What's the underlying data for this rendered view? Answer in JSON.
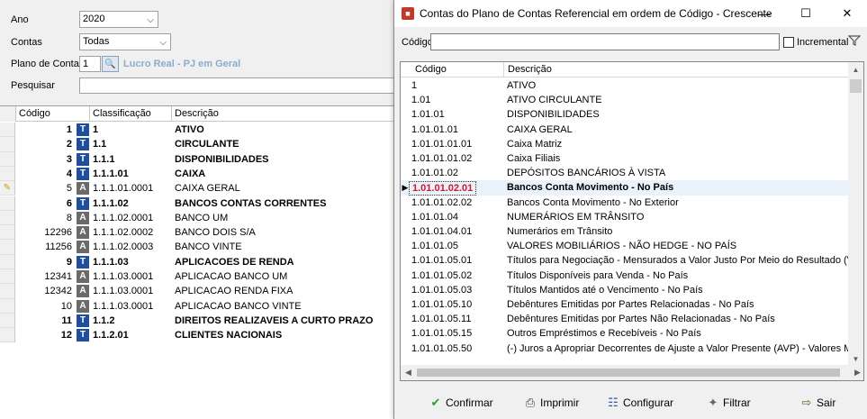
{
  "form": {
    "ano_label": "Ano",
    "ano_value": "2020",
    "contas_label": "Contas",
    "contas_value": "Todas",
    "plano_label": "Plano de Contas",
    "plano_value": "1",
    "plano_desc": "Lucro Real - PJ em Geral",
    "pesquisar_label": "Pesquisar"
  },
  "left_grid": {
    "headers": [
      "Código",
      "Classificação",
      "Descrição"
    ],
    "rows": [
      {
        "code": "1",
        "type": "T",
        "cls": "1",
        "desc": "ATIVO",
        "bold": true
      },
      {
        "code": "2",
        "type": "T",
        "cls": "1.1",
        "desc": "CIRCULANTE",
        "bold": true
      },
      {
        "code": "3",
        "type": "T",
        "cls": "1.1.1",
        "desc": "DISPONIBILIDADES",
        "bold": true
      },
      {
        "code": "4",
        "type": "T",
        "cls": "1.1.1.01",
        "desc": "CAIXA",
        "bold": true
      },
      {
        "code": "5",
        "type": "A",
        "cls": "1.1.1.01.0001",
        "desc": "CAIXA GERAL",
        "bold": false,
        "editing": true
      },
      {
        "code": "6",
        "type": "T",
        "cls": "1.1.1.02",
        "desc": "BANCOS CONTAS CORRENTES",
        "bold": true
      },
      {
        "code": "8",
        "type": "A",
        "cls": "1.1.1.02.0001",
        "desc": "BANCO UM",
        "bold": false
      },
      {
        "code": "12296",
        "type": "A",
        "cls": "1.1.1.02.0002",
        "desc": "BANCO DOIS S/A",
        "bold": false
      },
      {
        "code": "11256",
        "type": "A",
        "cls": "1.1.1.02.0003",
        "desc": "BANCO VINTE",
        "bold": false
      },
      {
        "code": "9",
        "type": "T",
        "cls": "1.1.1.03",
        "desc": "APLICACOES DE RENDA",
        "bold": true
      },
      {
        "code": "12341",
        "type": "A",
        "cls": "1.1.1.03.0001",
        "desc": "APLICACAO BANCO UM",
        "bold": false
      },
      {
        "code": "12342",
        "type": "A",
        "cls": "1.1.1.03.0001",
        "desc": "APLICACAO RENDA FIXA",
        "bold": false
      },
      {
        "code": "10",
        "type": "A",
        "cls": "1.1.1.03.0001",
        "desc": "APLICACAO BANCO VINTE",
        "bold": false
      },
      {
        "code": "11",
        "type": "T",
        "cls": "1.1.2",
        "desc": "DIREITOS REALIZAVEIS A CURTO PRAZO",
        "bold": true
      },
      {
        "code": "12",
        "type": "T",
        "cls": "1.1.2.01",
        "desc": "CLIENTES NACIONAIS",
        "bold": true
      }
    ]
  },
  "dialog": {
    "title": "Contas do Plano de Contas Referencial em ordem de Código - Crescente",
    "filter_label": "Código",
    "incremental_label": "Incremental",
    "headers": [
      "Código",
      "Descrição"
    ],
    "rows": [
      {
        "code": "1",
        "desc": "ATIVO"
      },
      {
        "code": "1.01",
        "desc": "ATIVO CIRCULANTE"
      },
      {
        "code": "1.01.01",
        "desc": "DISPONIBILIDADES"
      },
      {
        "code": "1.01.01.01",
        "desc": "CAIXA GERAL"
      },
      {
        "code": "1.01.01.01.01",
        "desc": "Caixa Matriz"
      },
      {
        "code": "1.01.01.01.02",
        "desc": "Caixa Filiais"
      },
      {
        "code": "1.01.01.02",
        "desc": "DEPÓSITOS BANCÁRIOS À VISTA"
      },
      {
        "code": "1.01.01.02.01",
        "desc": "Bancos Conta Movimento - No País",
        "selected": true
      },
      {
        "code": "1.01.01.02.02",
        "desc": "Bancos Conta Movimento - No Exterior"
      },
      {
        "code": "1.01.01.04",
        "desc": "NUMERÁRIOS EM TRÂNSITO"
      },
      {
        "code": "1.01.01.04.01",
        "desc": "Numerários em Trânsito"
      },
      {
        "code": "1.01.01.05",
        "desc": "VALORES MOBILIÁRIOS  - NÃO HEDGE - NO PAÍS"
      },
      {
        "code": "1.01.01.05.01",
        "desc": "Títulos para Negociação - Mensurados a Valor Justo Por Meio do Resultado (VJPR) - No P"
      },
      {
        "code": "1.01.01.05.02",
        "desc": "Títulos Disponíveis para Venda - No País"
      },
      {
        "code": "1.01.01.05.03",
        "desc": "Títulos Mantidos até o Vencimento - No País"
      },
      {
        "code": "1.01.01.05.10",
        "desc": "Debêntures Emitidas por Partes Relacionadas - No País"
      },
      {
        "code": "1.01.01.05.11",
        "desc": "Debêntures Emitidas por Partes Não Relacionadas - No País"
      },
      {
        "code": "1.01.01.05.15",
        "desc": "Outros Empréstimos e Recebíveis - No País"
      },
      {
        "code": "1.01.01.05.50",
        "desc": "(-) Juros a Apropriar Decorrentes de Ajuste a Valor Presente (AVP) -  Valores Mobiliários - N"
      }
    ],
    "buttons": {
      "confirmar": "Confirmar",
      "imprimir": "Imprimir",
      "configurar": "Configurar",
      "filtrar": "Filtrar",
      "sair": "Sair"
    }
  }
}
